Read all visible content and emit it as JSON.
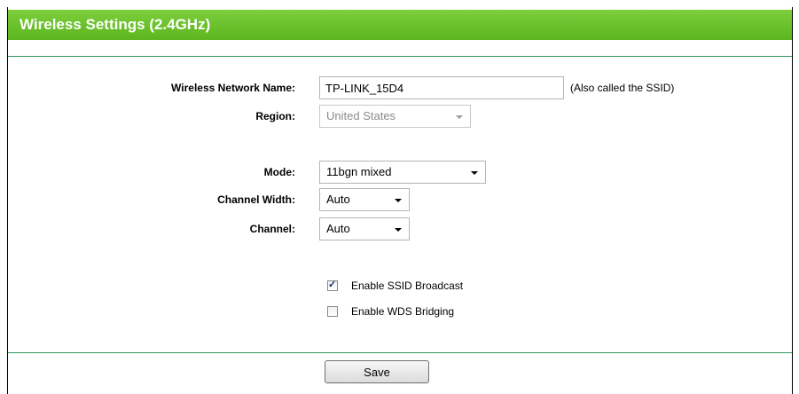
{
  "header": {
    "title": "Wireless Settings (2.4GHz)"
  },
  "form": {
    "network_name": {
      "label": "Wireless Network Name:",
      "value": "TP-LINK_15D4",
      "hint": "(Also called the SSID)"
    },
    "region": {
      "label": "Region:",
      "value": "United States",
      "disabled": true
    },
    "mode": {
      "label": "Mode:",
      "value": "11bgn mixed"
    },
    "channel_width": {
      "label": "Channel Width:",
      "value": "Auto"
    },
    "channel": {
      "label": "Channel:",
      "value": "Auto"
    },
    "ssid_broadcast": {
      "label": "Enable SSID Broadcast",
      "checked": true
    },
    "wds_bridging": {
      "label": "Enable WDS Bridging",
      "checked": false
    }
  },
  "actions": {
    "save_label": "Save"
  },
  "colors": {
    "header_green": "#6cc22e",
    "divider": "#2e9a5a"
  }
}
